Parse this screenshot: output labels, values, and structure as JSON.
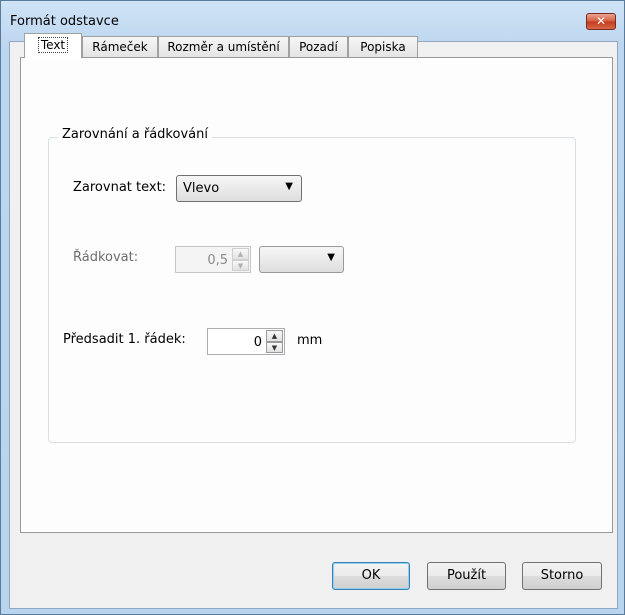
{
  "window": {
    "title": "Formát odstavce",
    "close_label": "✕"
  },
  "tabs": [
    {
      "label": "Text",
      "active": true
    },
    {
      "label": "Rámeček",
      "active": false
    },
    {
      "label": "Rozměr a umístění",
      "active": false
    },
    {
      "label": "Pozadí",
      "active": false
    },
    {
      "label": "Popiska",
      "active": false
    }
  ],
  "group": {
    "title": "Zarovnání a řádkování",
    "align": {
      "label": "Zarovnat text:",
      "value": "Vlevo",
      "enabled": true
    },
    "line_spacing": {
      "label": "Řádkovat:",
      "value": "0,5",
      "unit_value": "",
      "enabled": false
    },
    "indent": {
      "label": "Předsadit 1. řádek:",
      "value": "0",
      "unit": "mm",
      "enabled": true
    }
  },
  "buttons": {
    "ok": "OK",
    "apply": "Použít",
    "cancel": "Storno"
  },
  "colors": {
    "title_bar": "#bcd6ef",
    "close_button": "#c23a1c",
    "dialog_bg": "#f0f0f0",
    "panel_bg": "#fdfdfd"
  }
}
